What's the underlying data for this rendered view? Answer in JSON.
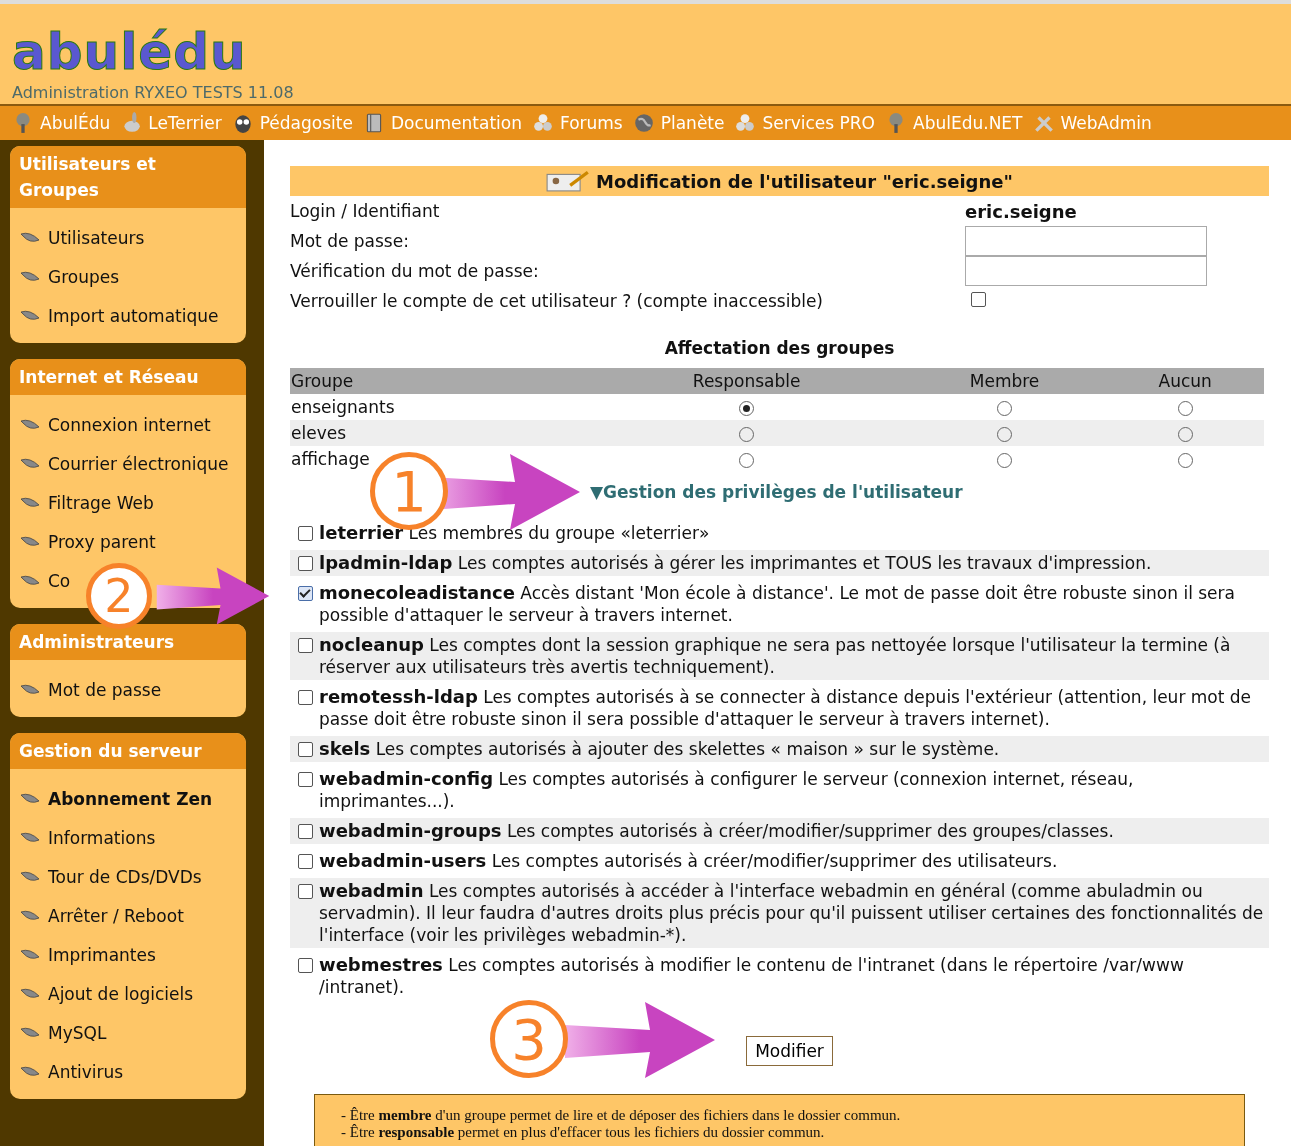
{
  "header": {
    "logo": "abulédu",
    "subtitle": "Administration RYXEO TESTS 11.08"
  },
  "menu": [
    {
      "label": "AbulÉdu"
    },
    {
      "label": "LeTerrier"
    },
    {
      "label": "Pédagosite"
    },
    {
      "label": "Documentation"
    },
    {
      "label": "Forums"
    },
    {
      "label": "Planète"
    },
    {
      "label": "Services PRO"
    },
    {
      "label": "AbulEdu.NET"
    },
    {
      "label": "WebAdmin"
    }
  ],
  "sidebar": [
    {
      "title": "Utilisateurs et Groupes",
      "items": [
        {
          "label": "Utilisateurs",
          "selected": false
        },
        {
          "label": "Groupes",
          "selected": false
        },
        {
          "label": "Import automatique",
          "selected": false
        }
      ]
    },
    {
      "title": "Internet et Réseau",
      "items": [
        {
          "label": "Connexion internet",
          "selected": false
        },
        {
          "label": "Courrier électronique",
          "selected": false
        },
        {
          "label": "Filtrage Web",
          "selected": false
        },
        {
          "label": "Proxy parent",
          "selected": false
        },
        {
          "label": "Co",
          "selected": false
        }
      ]
    },
    {
      "title": "Administrateurs",
      "items": [
        {
          "label": "Mot de passe",
          "selected": false
        }
      ]
    },
    {
      "title": "Gestion du serveur",
      "items": [
        {
          "label": "Abonnement Zen",
          "selected": true
        },
        {
          "label": "Informations",
          "selected": false
        },
        {
          "label": "Tour de CDs/DVDs",
          "selected": false
        },
        {
          "label": "Arrêter / Reboot",
          "selected": false
        },
        {
          "label": "Imprimantes",
          "selected": false
        },
        {
          "label": "Ajout de logiciels",
          "selected": false
        },
        {
          "label": "MySQL",
          "selected": false
        },
        {
          "label": "Antivirus",
          "selected": false
        }
      ]
    }
  ],
  "form": {
    "title": "Modification de l'utilisateur \"eric.seigne\"",
    "login_label": "Login / Identifiant",
    "login_value": "eric.seigne",
    "password_label": "Mot de passe:",
    "verify_label": "Vérification du mot de passe:",
    "lock_label": "Verrouiller le compte de cet utilisateur ? (compte inaccessible)",
    "lock_checked": false
  },
  "groups": {
    "title": "Affectation des groupes",
    "columns": [
      "Groupe",
      "Responsable",
      "Membre",
      "Aucun"
    ],
    "rows": [
      {
        "name": "enseignants",
        "choices": [
          {
            "selected": true
          },
          {
            "selected": false
          },
          {
            "selected": false
          }
        ]
      },
      {
        "name": "eleves",
        "choices": [
          {
            "selected": false
          },
          {
            "selected": false
          },
          {
            "selected": false
          }
        ]
      },
      {
        "name": "affichage",
        "choices": [
          {
            "selected": false
          },
          {
            "selected": false
          },
          {
            "selected": false
          }
        ]
      }
    ]
  },
  "privileges": {
    "toggle_icon": "▼",
    "title": "Gestion des privilèges de l'utilisateur",
    "items": [
      {
        "text": "**leterrier** Les membres du groupe «leterrier»",
        "checked": false
      },
      {
        "text": "**lpadmin-ldap** Les comptes autorisés à gérer les imprimantes et TOUS les travaux d'impression.",
        "checked": false
      },
      {
        "text": "**monecoleadistance** Accès distant 'Mon école à distance'. Le mot de passe doit être robuste sinon il sera possible d'attaquer le serveur à travers internet.",
        "checked": true
      },
      {
        "text": "**nocleanup** Les comptes dont la session graphique ne sera pas nettoyée lorsque l'utilisateur la termine (à réserver aux utilisateurs très avertis techniquement).",
        "checked": false
      },
      {
        "text": "**remotessh-ldap** Les comptes autorisés à se connecter à distance depuis l'extérieur (attention, leur mot de passe doit être robuste sinon il sera possible d'attaquer le serveur à travers internet).",
        "checked": false
      },
      {
        "text": "**skels** Les comptes autorisés à ajouter des skelettes « maison » sur le système.",
        "checked": false
      },
      {
        "text": "**webadmin-config** Les comptes autorisés à configurer le serveur (connexion internet, réseau, imprimantes...).",
        "checked": false
      },
      {
        "text": "**webadmin-groups** Les comptes autorisés à créer/modifier/supprimer des groupes/classes.",
        "checked": false
      },
      {
        "text": "**webadmin-users** Les comptes autorisés à créer/modifier/supprimer des utilisateurs.",
        "checked": false
      },
      {
        "text": "**webadmin** Les comptes autorisés à accéder à l'interface webadmin en général (comme abuladmin ou servadmin). Il leur faudra d'autres droits plus précis pour qu'il puissent utiliser certaines des fonctionnalités de l'interface (voir les privilèges webadmin-*).",
        "checked": false
      },
      {
        "text": "**webmestres** Les comptes autorisés à modifier le contenu de l'intranet (dans le répertoire /var/www /intranet).",
        "checked": false
      }
    ]
  },
  "submit": "Modifier",
  "notes": [
    "- Être **membre** d'un groupe permet de lire et de déposer des fichiers dans le dossier commun.",
    "- Être **responsable** permet en plus d'effacer tous les fichiers du dossier commun."
  ],
  "callouts": [
    "1",
    "2",
    "3"
  ]
}
